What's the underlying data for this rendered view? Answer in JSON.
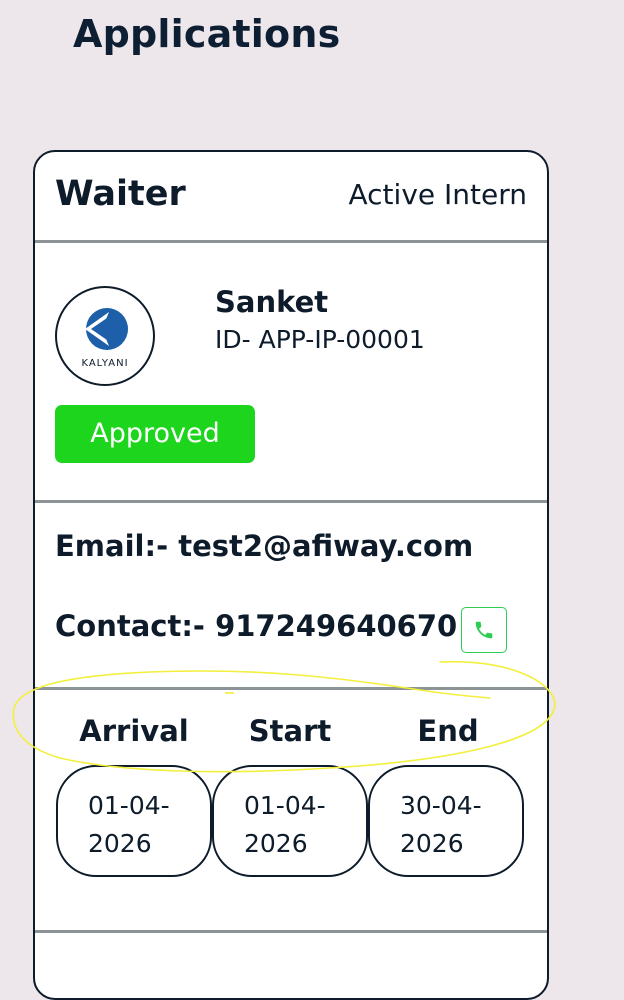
{
  "page": {
    "title": "Applications"
  },
  "application": {
    "job_title": "Waiter",
    "job_status": "Active Intern",
    "company_logo": {
      "icon": "kalyani-logo",
      "text": "KALYANI",
      "colors": {
        "blue": "#1d5fa8",
        "dark": "#0d1b2a"
      }
    },
    "applicant_name": "Sanket",
    "applicant_id": "ID- APP-IP-00001",
    "status": "Approved",
    "status_color": "#1cd51c",
    "email_line": "Email:- test2@afiway.com",
    "contact_line": "Contact:- 917249640670",
    "call_icon": "phone-icon",
    "call_icon_color": "#2ecc52",
    "dates": {
      "arrival_label": "Arrival",
      "start_label": "Start",
      "end_label": "End",
      "arrival_line1": "01-04-",
      "arrival_line2": "2026",
      "start_line1": "01-04-",
      "start_line2": "2026",
      "end_line1": "30-04-",
      "end_line2": "2026"
    }
  },
  "annotation": {
    "shape": "ellipse",
    "color": "#f2ef3d"
  }
}
